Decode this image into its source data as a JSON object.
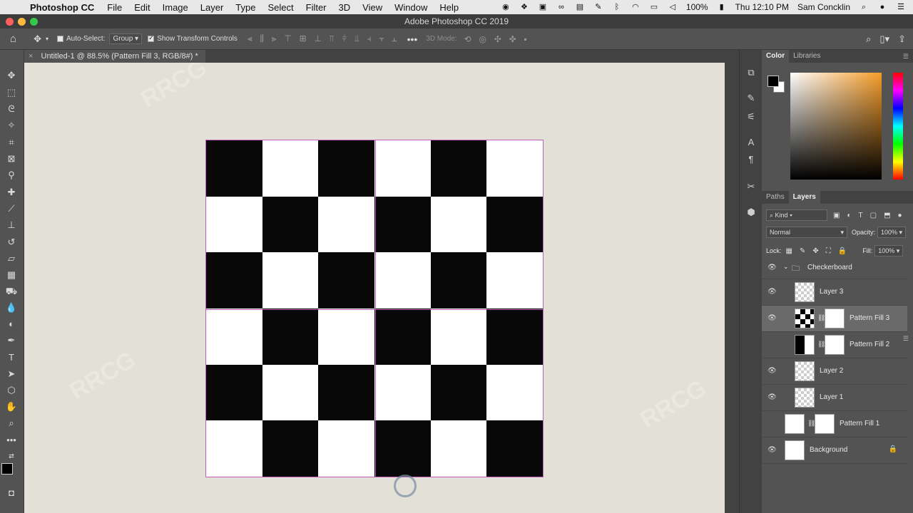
{
  "menubar": {
    "app": "Photoshop CC",
    "items": [
      "File",
      "Edit",
      "Image",
      "Layer",
      "Type",
      "Select",
      "Filter",
      "3D",
      "View",
      "Window",
      "Help"
    ],
    "battery": "100%",
    "clock": "Thu 12:10 PM",
    "user": "Sam Concklin"
  },
  "window": {
    "title": "Adobe Photoshop CC 2019"
  },
  "options": {
    "auto_select_label": "Auto-Select:",
    "auto_select_value": "Group",
    "show_transform_label": "Show Transform Controls",
    "mode_3d_label": "3D Mode:"
  },
  "document": {
    "tab_title": "Untitled-1 @ 88.5% (Pattern Fill 3, RGB/8#) *"
  },
  "canvas": {
    "checker_pattern": [
      [
        "b",
        "w",
        "b",
        "w",
        "b",
        "w"
      ],
      [
        "w",
        "b",
        "w",
        "b",
        "w",
        "b"
      ],
      [
        "b",
        "w",
        "b",
        "w",
        "b",
        "w"
      ],
      [
        "w",
        "b",
        "w",
        "b",
        "w",
        "b"
      ],
      [
        "b",
        "w",
        "b",
        "w",
        "b",
        "w"
      ],
      [
        "w",
        "b",
        "w",
        "b",
        "w",
        "b"
      ]
    ],
    "colors": {
      "black": "#080808",
      "white": "#ffffff",
      "guide": "#b85ab8",
      "pasteboard": "#e2e0d7"
    }
  },
  "color_panel": {
    "tabs": [
      "Color",
      "Libraries"
    ]
  },
  "layers_panel": {
    "tabs": [
      "Paths",
      "Layers"
    ],
    "kind_label": "Kind",
    "blend_mode": "Normal",
    "opacity_label": "Opacity:",
    "opacity_value": "100%",
    "lock_label": "Lock:",
    "fill_label": "Fill:",
    "fill_value": "100%",
    "layers": [
      {
        "name": "Checkerboard",
        "type": "group",
        "visible": true
      },
      {
        "name": "Layer 3",
        "type": "pixel",
        "visible": true
      },
      {
        "name": "Pattern Fill 3",
        "type": "fill",
        "visible": true,
        "selected": true
      },
      {
        "name": "Pattern Fill 2",
        "type": "fill",
        "visible": false
      },
      {
        "name": "Layer 2",
        "type": "pixel",
        "visible": true
      },
      {
        "name": "Layer 1",
        "type": "pixel",
        "visible": true
      },
      {
        "name": "Pattern Fill 1",
        "type": "fill",
        "visible": false
      },
      {
        "name": "Background",
        "type": "background",
        "visible": true,
        "locked": true
      }
    ]
  }
}
